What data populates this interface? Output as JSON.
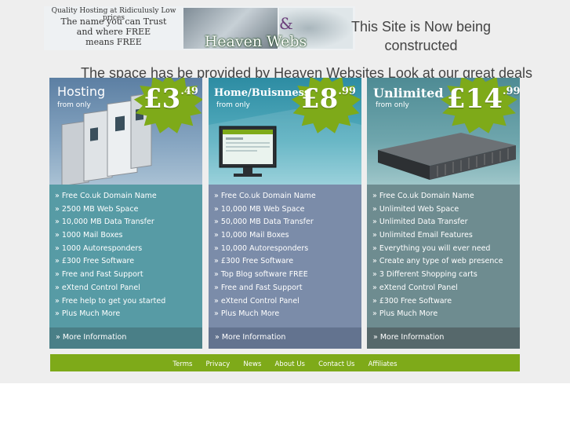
{
  "banner": {
    "line1": "Quality Hosting at Ridiculusly Low prices",
    "line2": "The name you can Trust",
    "line3": "and where FREE",
    "line4": "means FREE",
    "logo": "Heaven Webs"
  },
  "notice": {
    "construction": "This Site is Now being constructed",
    "provided": "The space has be provided by Heaven Websites Look at our great deals"
  },
  "plans": [
    {
      "title": "Hosting",
      "subtitle": "from only",
      "price_main": "£3",
      "price_cents": ".49",
      "features": [
        "» Free Co.uk Domain Name",
        "» 2500 MB Web Space",
        "» 10,000 MB Data Transfer",
        "» 1000 Mail Boxes",
        "» 1000 Autoresponders",
        "» £300 Free Software",
        "» Free and Fast Support",
        "» eXtend Control Panel",
        "» Free help to get you started",
        "» Plus Much More"
      ],
      "more": "» More Information"
    },
    {
      "title": "Home/Buisnness",
      "subtitle": "from only",
      "price_main": "£8",
      "price_cents": ".99",
      "features": [
        "» Free Co.uk Domain Name",
        "» 10,000 MB Web Space",
        "» 50,000 MB Data Transfer",
        "» 10,000 Mail Boxes",
        "» 10,000 Autoresponders",
        "» £300 Free Software",
        "» Top Blog software FREE",
        "» Free and Fast Support",
        "» eXtend Control Panel",
        "» Plus Much More"
      ],
      "more": "» More Information"
    },
    {
      "title": "Unlimited",
      "subtitle": "from only",
      "price_main": "£14",
      "price_cents": ".99",
      "features": [
        "» Free Co.uk Domain Name",
        "» Unlimited Web Space",
        "» Unlimited Data Transfer",
        "» Unlimited Email Features",
        "» Everything you will ever need",
        "» Create any type of web presence",
        "» 3 Different Shopping carts",
        "» eXtend Control Panel",
        "» £300 Free Software",
        "» Plus Much More"
      ],
      "more": "» More Information"
    }
  ],
  "footer": [
    "Terms",
    "Privacy",
    "News",
    "About Us",
    "Contact Us",
    "Affiliates"
  ],
  "colors": {
    "accent_green": "#7eaa19",
    "hosting_body": "#579ba5",
    "business_body": "#7b8ca9",
    "unlimited_body": "#6e8c90"
  }
}
